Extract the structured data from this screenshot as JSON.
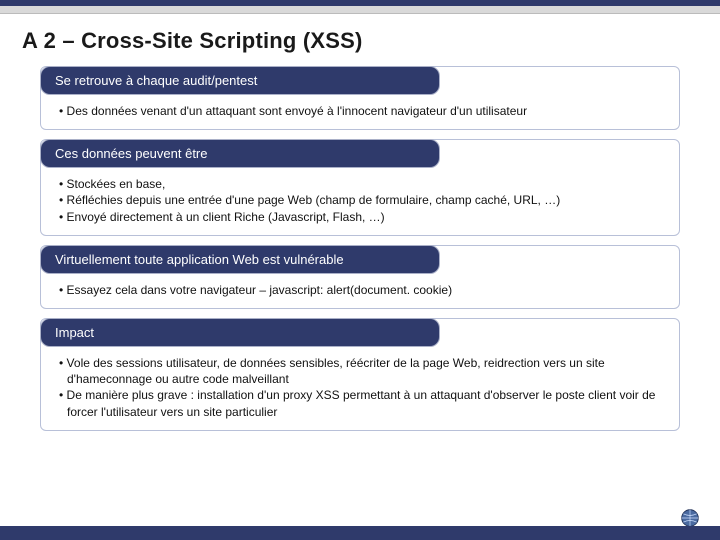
{
  "title": "A 2 – Cross-Site Scripting (XSS)",
  "sections": [
    {
      "header": "Se retrouve à chaque audit/pentest",
      "bullets": [
        "Des données venant d'un attaquant sont envoyé à l'innocent navigateur d'un utilisateur"
      ]
    },
    {
      "header": "Ces données peuvent être",
      "bullets": [
        "Stockées en base,",
        "Réfléchies depuis une entrée d'une page Web (champ de formulaire, champ caché, URL, …)",
        "Envoyé directement à un client Riche (Javascript, Flash, …)"
      ]
    },
    {
      "header": "Virtuellement toute application Web est vulnérable",
      "bullets": [
        "Essayez cela dans votre navigateur – javascript: alert(document. cookie)"
      ]
    },
    {
      "header": "Impact",
      "bullets": [
        "Vole des sessions utilisateur, de données sensibles, réécriter de la page Web, reidrection vers un site d'hameconnage ou autre code malveillant",
        "De manière plus grave : installation d'un proxy XSS permettant à un attaquant d'observer le poste client voir de forcer l'utilisateur vers un site particulier"
      ]
    }
  ],
  "colors": {
    "accent": "#2f3a6b",
    "border": "#b8c0d8"
  }
}
